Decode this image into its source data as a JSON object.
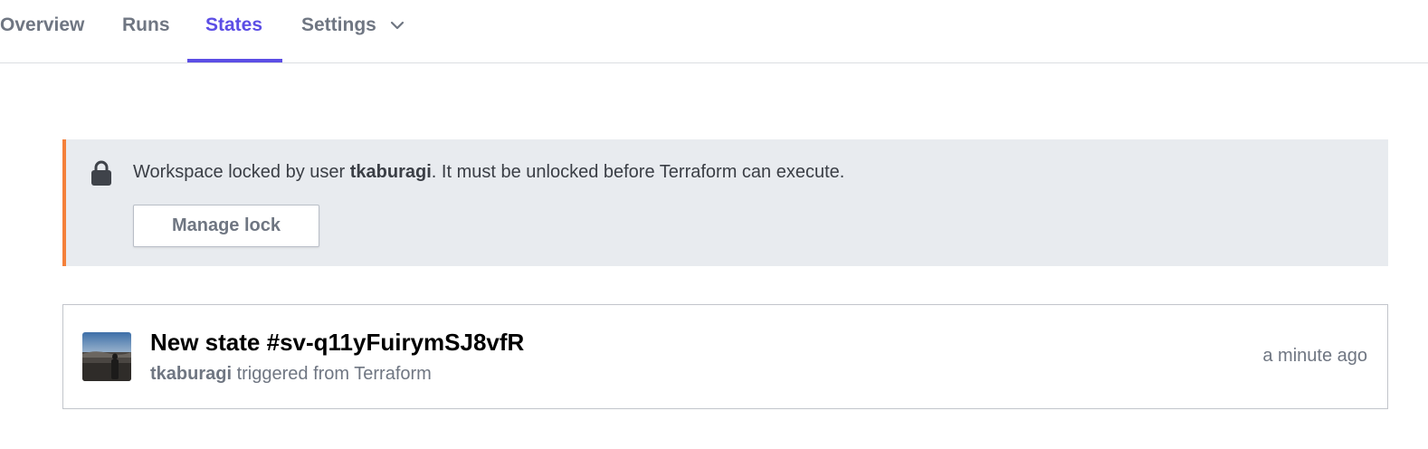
{
  "tabs": [
    {
      "label": "Overview",
      "active": false
    },
    {
      "label": "Runs",
      "active": false
    },
    {
      "label": "States",
      "active": true
    },
    {
      "label": "Settings",
      "active": false,
      "has_dropdown": true
    }
  ],
  "colors": {
    "accent": "#5c4ee5",
    "banner_bg": "#e8ebef",
    "banner_warning": "#f4803a"
  },
  "lock_banner": {
    "icon": "lock-icon",
    "message_prefix": "Workspace locked by user ",
    "locked_by": "tkaburagi",
    "message_suffix": ". It must be unlocked before Terraform can execute.",
    "button_label": "Manage lock"
  },
  "states": [
    {
      "title": "New state #sv-q11yFuirymSJ8vfR",
      "user": "tkaburagi",
      "trigger_text": " triggered from Terraform",
      "time": "a minute ago"
    }
  ]
}
